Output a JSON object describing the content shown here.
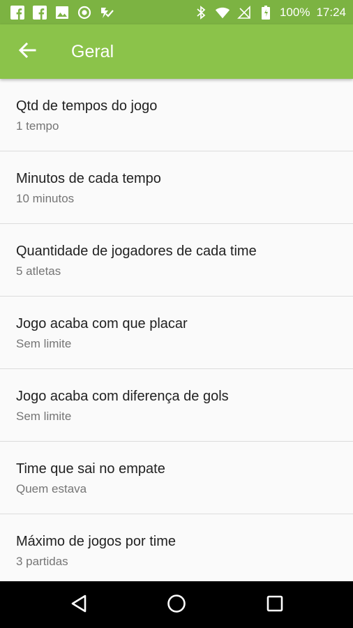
{
  "status_bar": {
    "notification_icons": [
      "facebook-icon",
      "facebook-icon",
      "image-icon",
      "radio-icon",
      "check-badge-icon"
    ],
    "system_icons": [
      "bluetooth-icon",
      "wifi-icon",
      "no-signal-icon",
      "battery-icon"
    ],
    "battery_text": "100%",
    "time": "17:24"
  },
  "app_bar": {
    "back_icon": "arrow-back-icon",
    "title": "Geral"
  },
  "settings": [
    {
      "title": "Qtd de tempos do jogo",
      "value": "1 tempo"
    },
    {
      "title": "Minutos de cada tempo",
      "value": "10 minutos"
    },
    {
      "title": "Quantidade de jogadores de cada time",
      "value": "5 atletas"
    },
    {
      "title": "Jogo acaba com que placar",
      "value": "Sem limite"
    },
    {
      "title": "Jogo acaba com diferença de gols",
      "value": "Sem limite"
    },
    {
      "title": "Time que sai no empate",
      "value": "Quem estava"
    },
    {
      "title": "Máximo de jogos por time",
      "value": "3 partidas"
    }
  ],
  "nav_bar": {
    "icons": [
      "back-triangle-icon",
      "home-circle-icon",
      "recents-square-icon"
    ]
  },
  "colors": {
    "status_bar": "#7cb342",
    "app_bar": "#8bc34a",
    "background": "#fafafa",
    "title_text": "#212121",
    "subtitle_text": "#757575",
    "divider": "#dcdcdc",
    "nav_bar": "#000000"
  }
}
